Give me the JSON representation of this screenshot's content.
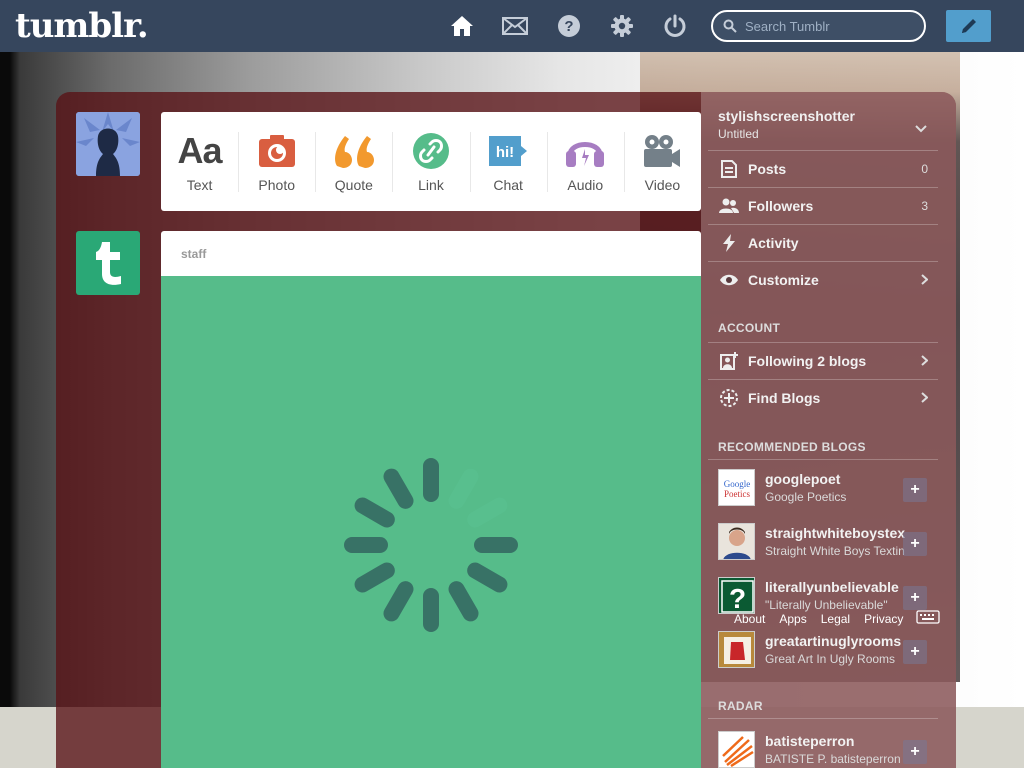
{
  "app": {
    "logo": "tumblr."
  },
  "nav": {
    "icons": [
      "home-icon",
      "mail-icon",
      "help-icon",
      "gear-icon",
      "power-icon"
    ],
    "search_placeholder": "Search Tumblr"
  },
  "post_types": [
    {
      "label": "Text",
      "icon": "Aa",
      "color": "#444444"
    },
    {
      "label": "Photo",
      "icon": "camera",
      "color": "#d95e40"
    },
    {
      "label": "Quote",
      "icon": "quote",
      "color": "#f2992e"
    },
    {
      "label": "Link",
      "icon": "link",
      "color": "#56bc8a"
    },
    {
      "label": "Chat",
      "icon": "hi!",
      "color": "#529ecc"
    },
    {
      "label": "Audio",
      "icon": "headphones",
      "color": "#a77dc2"
    },
    {
      "label": "Video",
      "icon": "video-camera",
      "color": "#748089"
    }
  ],
  "post": {
    "author": "staff",
    "bg_color": "#56bc8a"
  },
  "sidebar": {
    "blog_name": "stylishscreenshotter",
    "blog_subtitle": "Untitled",
    "items": [
      {
        "label": "Posts",
        "count": "0"
      },
      {
        "label": "Followers",
        "count": "3"
      },
      {
        "label": "Activity",
        "count": ""
      },
      {
        "label": "Customize",
        "count": ""
      }
    ],
    "account_heading": "ACCOUNT",
    "account_items": [
      {
        "label": "Following 2 blogs"
      },
      {
        "label": "Find Blogs"
      }
    ],
    "recommended_heading": "RECOMMENDED BLOGS",
    "recommended": [
      {
        "name": "googlepoet",
        "desc": "Google Poetics"
      },
      {
        "name": "straightwhiteboystexting",
        "desc": "Straight White Boys Texting"
      },
      {
        "name": "literallyunbelievable",
        "desc": "\"Literally Unbelievable\""
      },
      {
        "name": "greatartinuglyrooms",
        "desc": "Great Art In Ugly Rooms"
      }
    ],
    "footer_links": [
      "About",
      "Apps",
      "Legal",
      "Privacy"
    ],
    "radar_heading": "RADAR",
    "radar": {
      "name": "batisteperron",
      "desc": "BATISTE P. batisteperron"
    }
  }
}
